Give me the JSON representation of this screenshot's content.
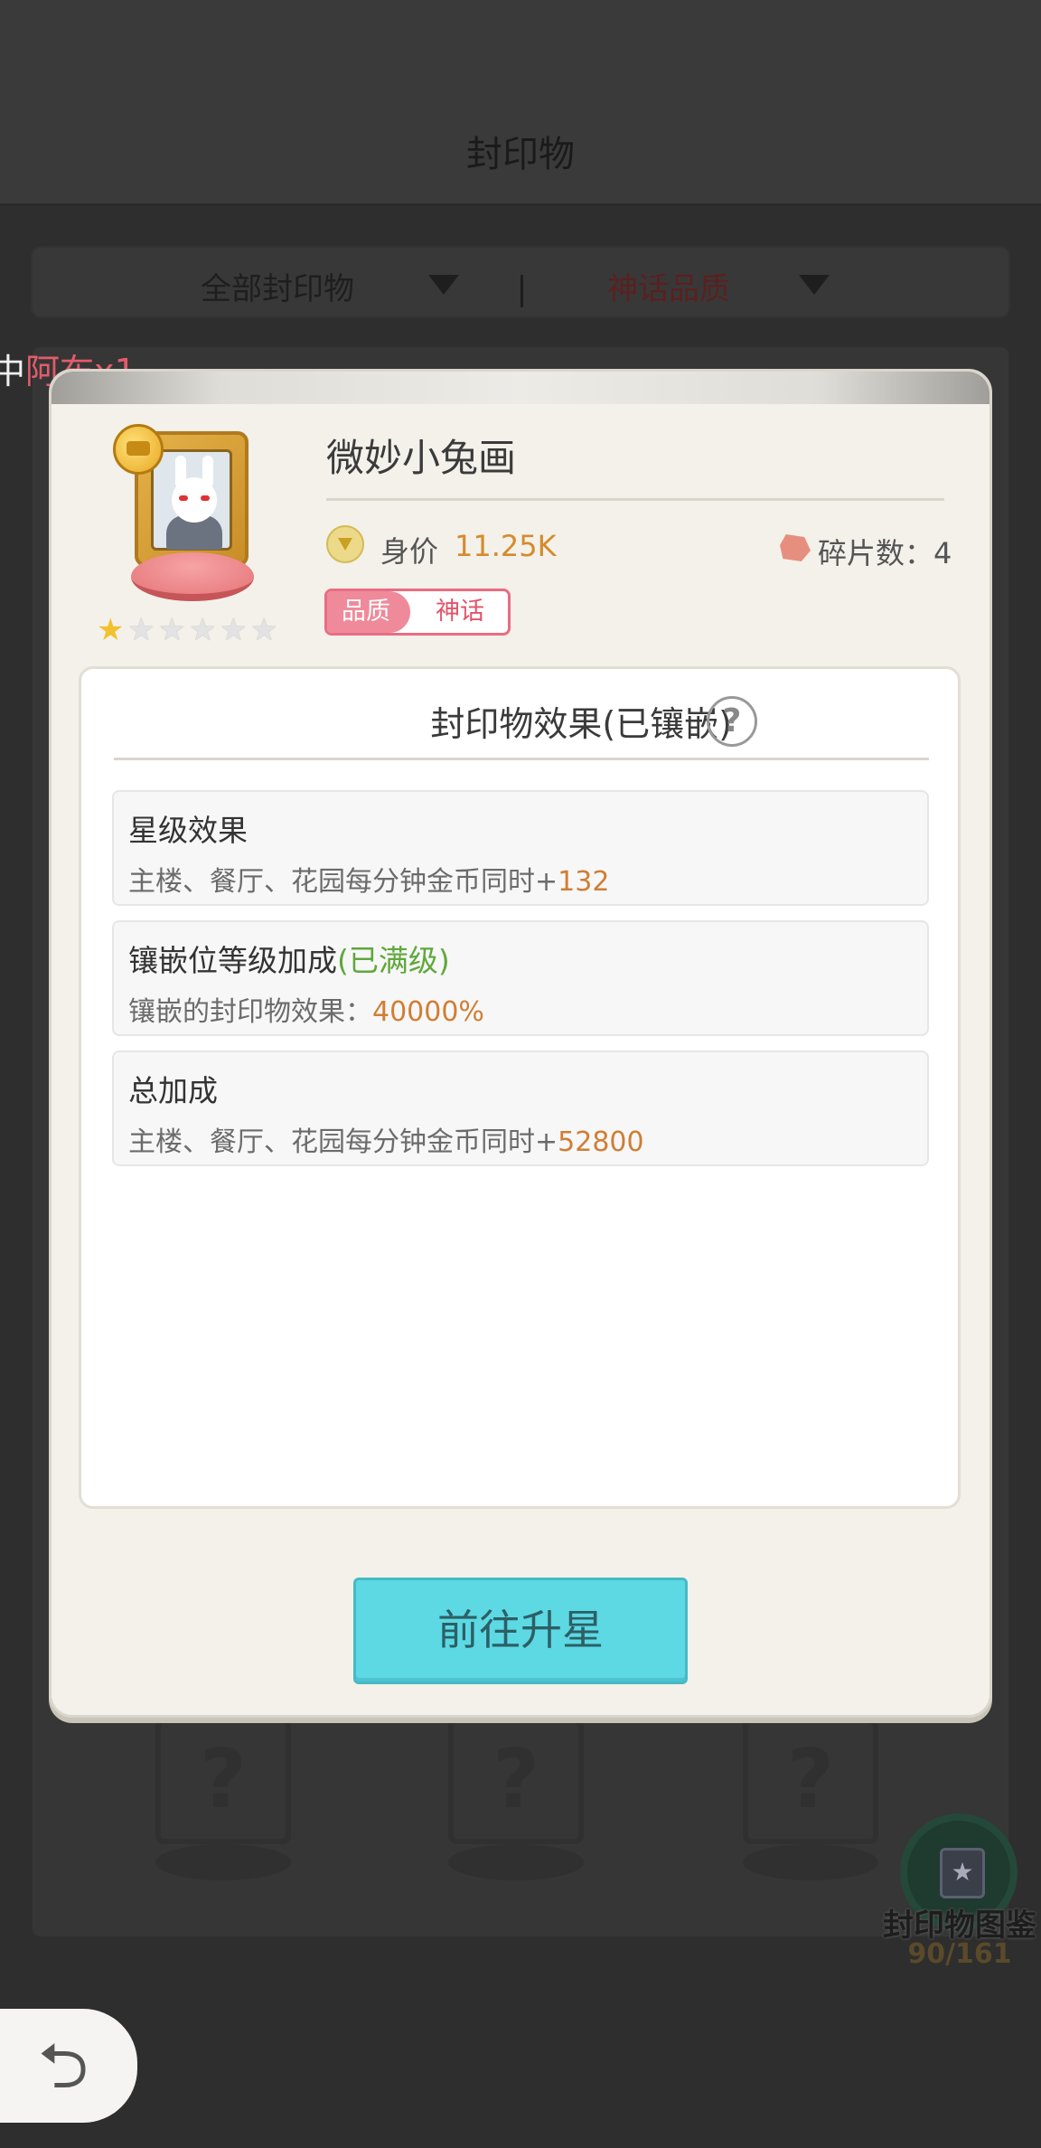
{
  "background": {
    "title": "封印物",
    "filters": {
      "left": "全部封印物",
      "right": "神话品质"
    },
    "ticker": {
      "prefix": "中",
      "highlight": "阿布x1"
    },
    "catalog": {
      "label": "封印物图鉴",
      "count": "90/161"
    }
  },
  "item": {
    "name": "微妙小兔画",
    "stars_filled": 1,
    "stars_total": 6,
    "price_label": "身价",
    "price_value": "11.25K",
    "shards": "碎片数：4",
    "quality_label": "品质",
    "quality_value": "神话"
  },
  "effects": {
    "title": "封印物效果(已镶嵌)",
    "help": "?",
    "cards": [
      {
        "title": "星级效果",
        "title_suffix": "",
        "desc": "主楼、餐厅、花园每分钟金币同时+",
        "value": "132"
      },
      {
        "title": "镶嵌位等级加成",
        "title_suffix": "(已满级)",
        "desc": "镶嵌的封印物效果：",
        "value": "40000%"
      },
      {
        "title": "总加成",
        "title_suffix": "",
        "desc": "主楼、餐厅、花园每分钟金币同时+",
        "value": "52800"
      }
    ]
  },
  "actions": {
    "upgrade": "前往升星"
  },
  "colors": {
    "accent_cyan": "#5cd9e3",
    "value_orange": "#d07e34",
    "max_level_green": "#5fa83a",
    "quality_pink": "#ea6c82"
  },
  "icons": [
    "coin-icon",
    "diamond-price-icon",
    "shard-icon",
    "help-icon",
    "star-icon",
    "catalog-book-icon",
    "back-arrow-icon"
  ]
}
